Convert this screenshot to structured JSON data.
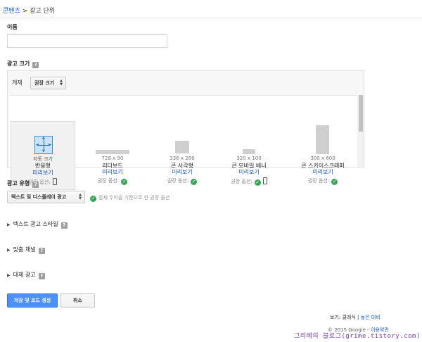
{
  "breadcrumb": {
    "parent": "콘텐츠",
    "separator": " > ",
    "current": "광고 단위"
  },
  "name_field": {
    "label": "이름",
    "value": "",
    "placeholder": ""
  },
  "help_icon_glyph": "?",
  "ad_size": {
    "label": "광고 크기",
    "placement_label": "게재",
    "placement_select": "권장 크기",
    "options": [
      {
        "dim": "",
        "name": "자동 크기",
        "name2": "반응형",
        "preview": "미리보기",
        "rec": "권장 옵션:",
        "rec_icon": "phone-icon",
        "selected": true
      },
      {
        "dim": "728 x 90",
        "name": "리더보드",
        "preview": "미리보기",
        "rec": "권장 옵션:",
        "rec_icon": "check-icon"
      },
      {
        "dim": "336 x 280",
        "name": "큰 사각형",
        "preview": "미리보기",
        "rec": "권장 옵션:",
        "rec_icon": "check-icon"
      },
      {
        "dim": "320 x 100",
        "name": "큰 모바일 배너",
        "preview": "미리보기",
        "rec": "권장 옵션:",
        "rec_icon": "check-icon, phone-icon"
      },
      {
        "dim": "300 x 600",
        "name": "큰 스카이스크래퍼",
        "preview": "미리보기",
        "rec": "권장 옵션:",
        "rec_icon": "check-icon"
      }
    ]
  },
  "ad_type": {
    "label": "광고 유형",
    "select": "텍스트 및 디스플레이 광고",
    "note": "잠재 수익을 기준으로 한 권장 옵션",
    "check_glyph": "✓"
  },
  "sections": {
    "text_style": "텍스트 광고 스타일",
    "custom_channel": "맞춤 채널",
    "backup_ads": "대체 광고"
  },
  "buttons": {
    "save": "저장 및 코드 생성",
    "cancel": "취소"
  },
  "footer": {
    "view_label": "보기:",
    "view_classic": "클래식",
    "view_sep": " | ",
    "view_high_contrast": "높은 대비",
    "copyright": "© 2015 Google - ",
    "terms": "이용약관"
  },
  "watermark": "그리메의 블로그(grime.tistory.com)",
  "colors": {
    "link": "#1155cc",
    "primary_button": "#4d90fe",
    "check": "#36a854",
    "watermark": "#7a3bb0"
  }
}
